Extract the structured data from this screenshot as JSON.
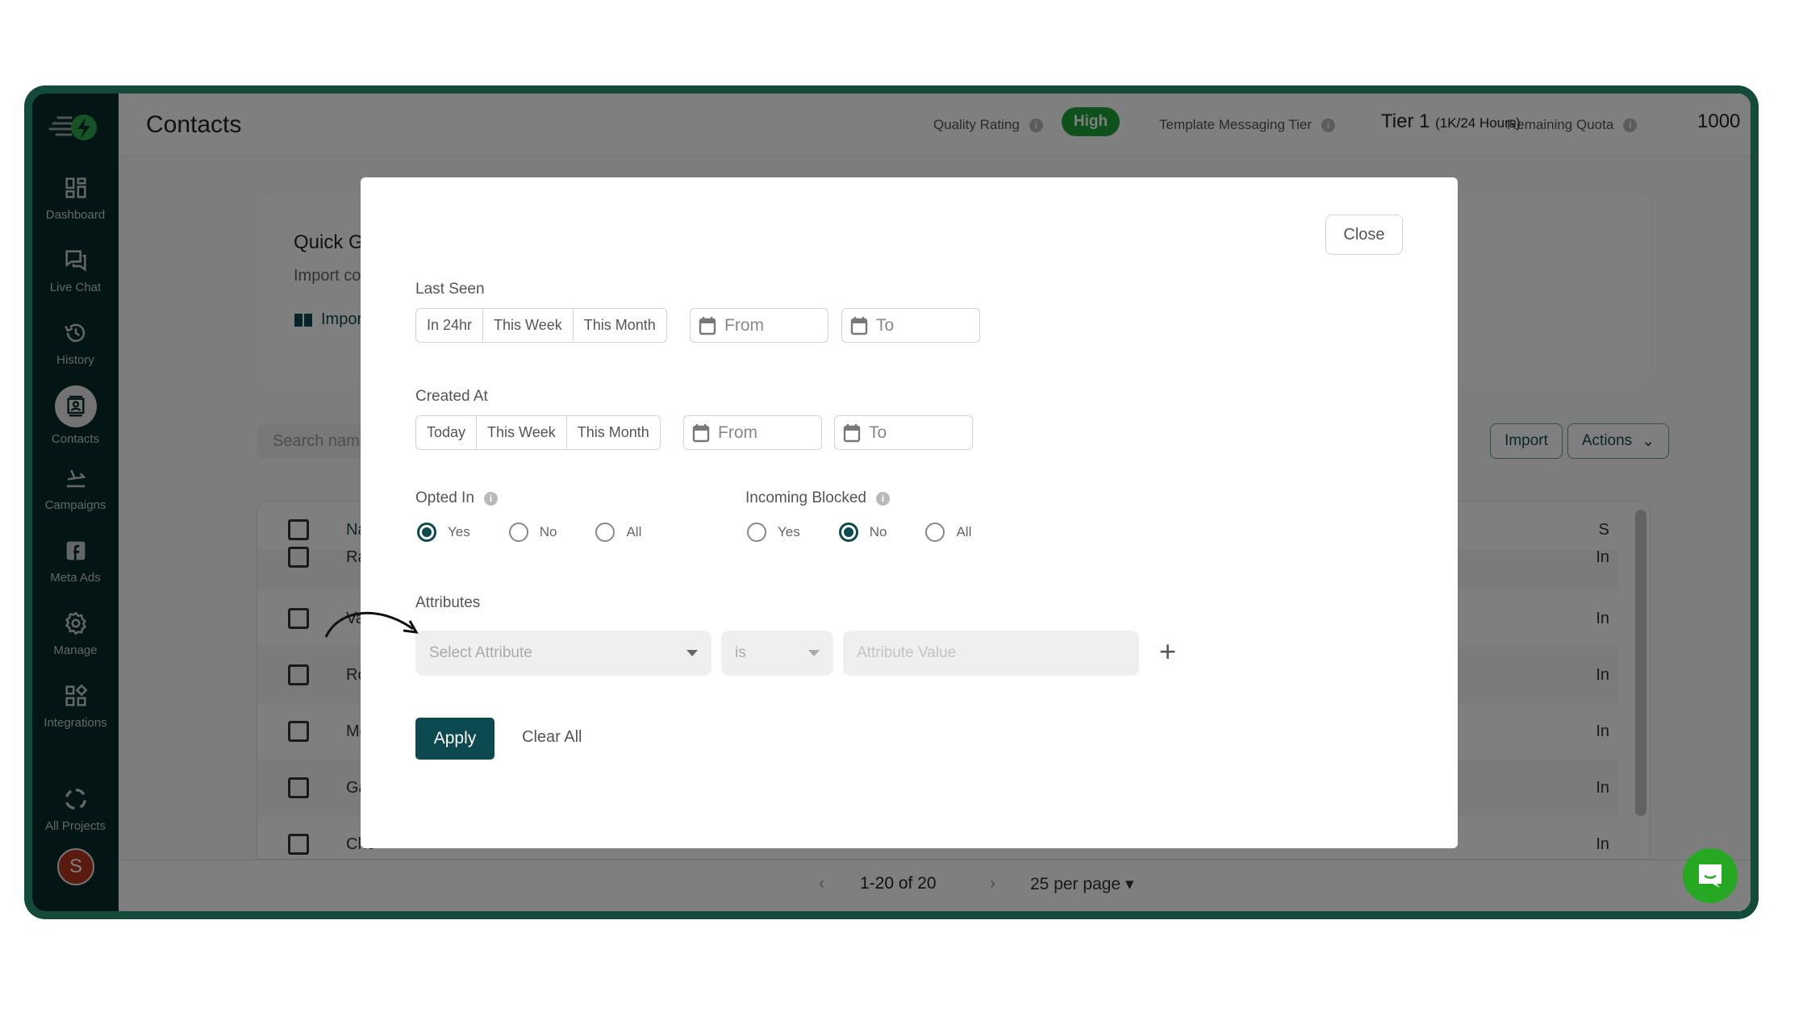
{
  "header": {
    "title": "Contacts",
    "quality_rating_label": "Quality Rating",
    "quality_rating_value": "High",
    "tier_label": "Template Messaging Tier",
    "tier_value": "Tier 1",
    "tier_detail": "(1K/24 Hours)",
    "quota_label": "Remaining Quota",
    "quota_value": "1000",
    "info_glyph": "i"
  },
  "sidebar": {
    "items": [
      {
        "label": "Dashboard",
        "icon": "dashboard-icon"
      },
      {
        "label": "Live Chat",
        "icon": "chat-icon"
      },
      {
        "label": "History",
        "icon": "history-icon"
      },
      {
        "label": "Contacts",
        "icon": "contacts-icon",
        "active": true
      },
      {
        "label": "Campaigns",
        "icon": "campaign-icon"
      },
      {
        "label": "Meta Ads",
        "icon": "facebook-icon"
      },
      {
        "label": "Manage",
        "icon": "gear-icon"
      },
      {
        "label": "Integrations",
        "icon": "integrations-icon"
      },
      {
        "label": "All Projects",
        "icon": "projects-icon"
      }
    ],
    "avatar_initial": "S"
  },
  "background": {
    "guide_title": "Quick Gu",
    "guide_sub": "Import co",
    "guide_link": "Import",
    "search_placeholder": "Search name",
    "import_label": "Import",
    "actions_label": "Actions",
    "table_header_name": "Na",
    "table_header_status": "S",
    "rows": [
      {
        "name": "Raj",
        "status": "In"
      },
      {
        "name": "Vai",
        "status": "In"
      },
      {
        "name": "Roc",
        "status": "In"
      },
      {
        "name": "Mo",
        "status": "In"
      },
      {
        "name": "Gau",
        "status": "In"
      },
      {
        "name": "Che",
        "status": "In"
      }
    ],
    "pagination": {
      "range": "1-20 of 20",
      "per_page": "25 per page",
      "prev": "‹",
      "next": "›"
    }
  },
  "modal": {
    "close_label": "Close",
    "last_seen": {
      "label": "Last Seen",
      "presets": [
        "In 24hr",
        "This Week",
        "This Month"
      ],
      "from_placeholder": "From",
      "to_placeholder": "To"
    },
    "created_at": {
      "label": "Created At",
      "presets": [
        "Today",
        "This Week",
        "This Month"
      ],
      "from_placeholder": "From",
      "to_placeholder": "To"
    },
    "opted_in": {
      "label": "Opted In",
      "options": [
        "Yes",
        "No",
        "All"
      ],
      "selected": "Yes"
    },
    "incoming_blocked": {
      "label": "Incoming Blocked",
      "options": [
        "Yes",
        "No",
        "All"
      ],
      "selected": "No"
    },
    "attributes": {
      "label": "Attributes",
      "select_placeholder": "Select Attribute",
      "operator": "is",
      "value_placeholder": "Attribute Value",
      "add_glyph": "+"
    },
    "apply_label": "Apply",
    "clear_label": "Clear All"
  },
  "colors": {
    "frame": "#134a3a",
    "sidebar": "#062a2b",
    "primary": "#0c4a4f",
    "badge_high": "#1fa33a",
    "chat_fab": "#27a822"
  }
}
